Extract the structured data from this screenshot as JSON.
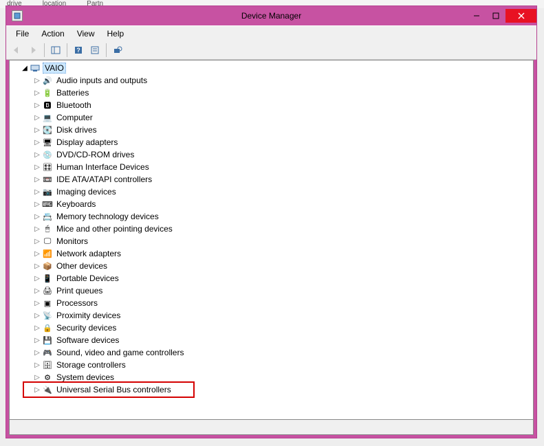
{
  "window": {
    "title": "Device Manager"
  },
  "menu": {
    "file": "File",
    "action": "Action",
    "view": "View",
    "help": "Help"
  },
  "tree": {
    "root": "VAIO",
    "items": [
      {
        "label": "Audio inputs and outputs",
        "icon": "🔊"
      },
      {
        "label": "Batteries",
        "icon": "🔋"
      },
      {
        "label": "Bluetooth",
        "icon": "🅱"
      },
      {
        "label": "Computer",
        "icon": "💻"
      },
      {
        "label": "Disk drives",
        "icon": "💽"
      },
      {
        "label": "Display adapters",
        "icon": "🖥"
      },
      {
        "label": "DVD/CD-ROM drives",
        "icon": "💿"
      },
      {
        "label": "Human Interface Devices",
        "icon": "🎛"
      },
      {
        "label": "IDE ATA/ATAPI controllers",
        "icon": "📼"
      },
      {
        "label": "Imaging devices",
        "icon": "📷"
      },
      {
        "label": "Keyboards",
        "icon": "⌨"
      },
      {
        "label": "Memory technology devices",
        "icon": "📇"
      },
      {
        "label": "Mice and other pointing devices",
        "icon": "🖱"
      },
      {
        "label": "Monitors",
        "icon": "🖵"
      },
      {
        "label": "Network adapters",
        "icon": "📶"
      },
      {
        "label": "Other devices",
        "icon": "📦"
      },
      {
        "label": "Portable Devices",
        "icon": "📱"
      },
      {
        "label": "Print queues",
        "icon": "🖨"
      },
      {
        "label": "Processors",
        "icon": "▣"
      },
      {
        "label": "Proximity devices",
        "icon": "📡"
      },
      {
        "label": "Security devices",
        "icon": "🔒"
      },
      {
        "label": "Software devices",
        "icon": "💾"
      },
      {
        "label": "Sound, video and game controllers",
        "icon": "🎮"
      },
      {
        "label": "Storage controllers",
        "icon": "🗄"
      },
      {
        "label": "System devices",
        "icon": "⚙"
      },
      {
        "label": "Universal Serial Bus controllers",
        "icon": "🔌"
      }
    ]
  },
  "highlight_index": 25
}
